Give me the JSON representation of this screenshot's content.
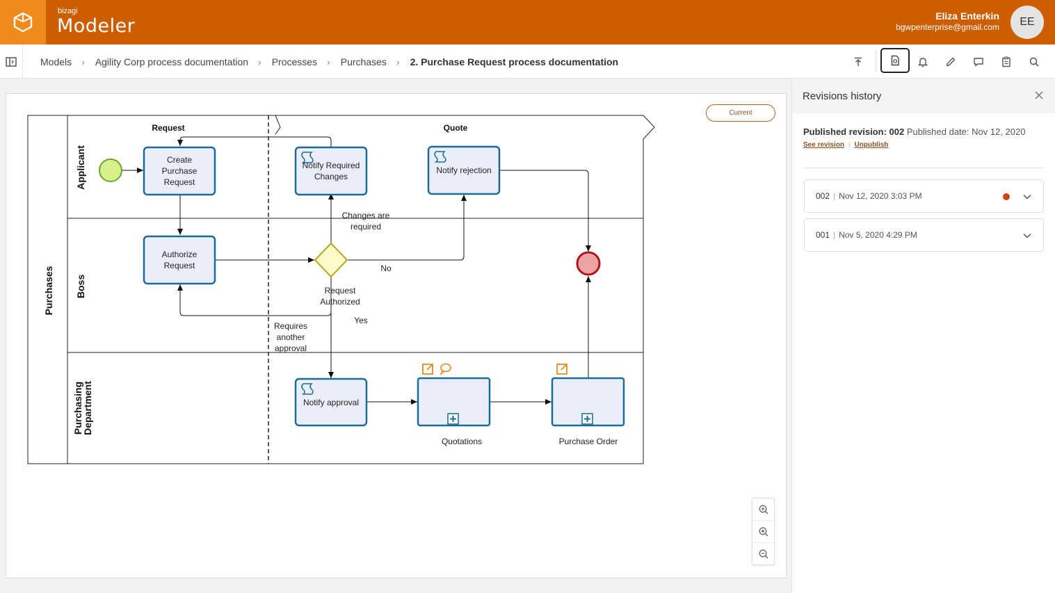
{
  "header": {
    "brand_small": "bizagi",
    "brand": "Modeler",
    "user_name": "Eliza Enterkin",
    "user_email": "bgwpenterprise@gmail.com",
    "user_initials": "EE",
    "accent_color": "#cc5e00"
  },
  "breadcrumb": {
    "items": [
      "Models",
      "Agility Corp process documentation",
      "Processes",
      "Purchases",
      "2. Purchase Request process documentation"
    ]
  },
  "toolbar": {
    "icons": [
      "publish-icon",
      "document-revisions-icon",
      "bell-icon",
      "pencil-icon",
      "comment-icon",
      "clipboard-icon",
      "search-icon"
    ],
    "active": "document-revisions-icon"
  },
  "canvas": {
    "current_badge": "Current",
    "zoom_controls": [
      "zoom-in-icon",
      "zoom-fit-icon",
      "zoom-out-icon"
    ]
  },
  "diagram": {
    "pool": "Purchases",
    "lanes": [
      "Applicant",
      "Boss",
      "Purchasing Department"
    ],
    "lane_purchasing_line1": "Purchasing",
    "lane_purchasing_line2": "Department",
    "phases": [
      "Request",
      "Quote"
    ],
    "tasks": {
      "create_l1": "Create",
      "create_l2": "Purchase",
      "create_l3": "Request",
      "notify_changes_l1": "Notify Required",
      "notify_changes_l2": "Changes",
      "notify_rejection": "Notify rejection",
      "authorize_l1": "Authorize",
      "authorize_l2": "Request",
      "notify_approval": "Notify approval",
      "quotations": "Quotations",
      "purchase_order": "Purchase Order"
    },
    "labels": {
      "changes_l1": "Changes are",
      "changes_l2": "required",
      "no": "No",
      "request_auth_l1": "Request",
      "request_auth_l2": "Authorized",
      "yes": "Yes",
      "requires_l1": "Requires",
      "requires_l2": "another",
      "requires_l3": "approval"
    }
  },
  "revisions_panel": {
    "title": "Revisions history",
    "published_label": "Published revision:",
    "published_revision": "002",
    "published_date_label": "Published date:",
    "published_date": "Nov 12, 2020",
    "see_revision": "See revision",
    "unpublish": "Unpublish",
    "revisions": [
      {
        "version": "002",
        "date": "Nov 12, 2020 3:03 PM",
        "current": true
      },
      {
        "version": "001",
        "date": "Nov 5, 2020 4:29 PM",
        "current": false
      }
    ],
    "current_dot_color": "#d6401f"
  }
}
